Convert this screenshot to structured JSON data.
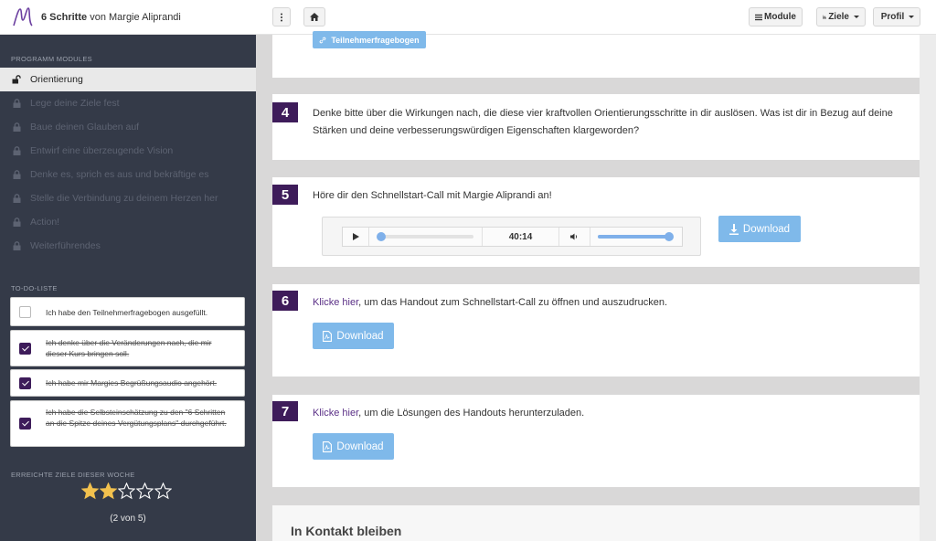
{
  "header": {
    "brand_strong": "6 Schritte",
    "brand_rest": "von Margie Aliprandi",
    "menu_icon": "dots-vertical-icon",
    "home_icon": "home-icon",
    "modules_label": "Module",
    "goals_label": "Ziele",
    "profile_label": "Profil"
  },
  "sidebar": {
    "modules_heading": "PROGRAMM MODULES",
    "modules": [
      {
        "label": "Orientierung",
        "state": "unlocked"
      },
      {
        "label": "Lege deine Ziele fest",
        "state": "locked"
      },
      {
        "label": "Baue deinen Glauben auf",
        "state": "locked"
      },
      {
        "label": "Entwirf eine überzeugende Vision",
        "state": "locked"
      },
      {
        "label": "Denke es, sprich es aus und bekräftige es",
        "state": "locked"
      },
      {
        "label": "Stelle die Verbindung zu deinem Herzen her",
        "state": "locked"
      },
      {
        "label": "Action!",
        "state": "locked"
      },
      {
        "label": "Weiterführendes",
        "state": "locked"
      }
    ],
    "todo_heading": "TO-DO-LISTE",
    "todos": [
      {
        "text": "Ich habe den Teilnehmerfragebogen ausgefüllt.",
        "done": false
      },
      {
        "text": "Ich denke über die Veränderungen nach, die mir dieser Kurs bringen soll.",
        "done": true
      },
      {
        "text": "Ich habe mir Margies Begrüßungsaudio angehört.",
        "done": true
      },
      {
        "text": "Ich habe die Selbsteinschätzung zu den \"6 Schritten an die Spitze deines Vergütungsplans\" durchgeführt.",
        "done": true
      }
    ],
    "goals_heading": "ERREICHTE ZIELE DIESER WOCHE",
    "stars_filled": 2,
    "stars_total": 5,
    "goals_caption": "(2 von 5)"
  },
  "main": {
    "top_button": "Teilnehmerfragebogen",
    "step4": {
      "number": "4",
      "text": "Denke bitte über die Wirkungen nach, die diese vier kraftvollen Orientierungsschritte in dir auslösen. Was ist dir in Bezug auf deine Stärken und deine verbesserungswürdigen Eigenschaften klargeworden?"
    },
    "step5": {
      "number": "5",
      "text": "Höre dir den Schnellstart-Call mit Margie Aliprandi an!",
      "time": "40:14",
      "progress": 0,
      "volume": 1,
      "download_label": "Download"
    },
    "step6": {
      "number": "6",
      "link": "Klicke hier",
      "rest": ", um das Handout zum Schnellstart-Call zu öffnen und auszudrucken.",
      "download_label": "Download"
    },
    "step7": {
      "number": "7",
      "link": "Klicke hier",
      "rest": ", um die Lösungen des Handouts herunterzuladen.",
      "download_label": "Download"
    },
    "contact_heading": "In Kontakt bleiben"
  },
  "colors": {
    "accent": "#3e1c5a",
    "download": "#7fb9ea",
    "sidebar": "#343a48",
    "player_track": "#7fb0ea"
  }
}
